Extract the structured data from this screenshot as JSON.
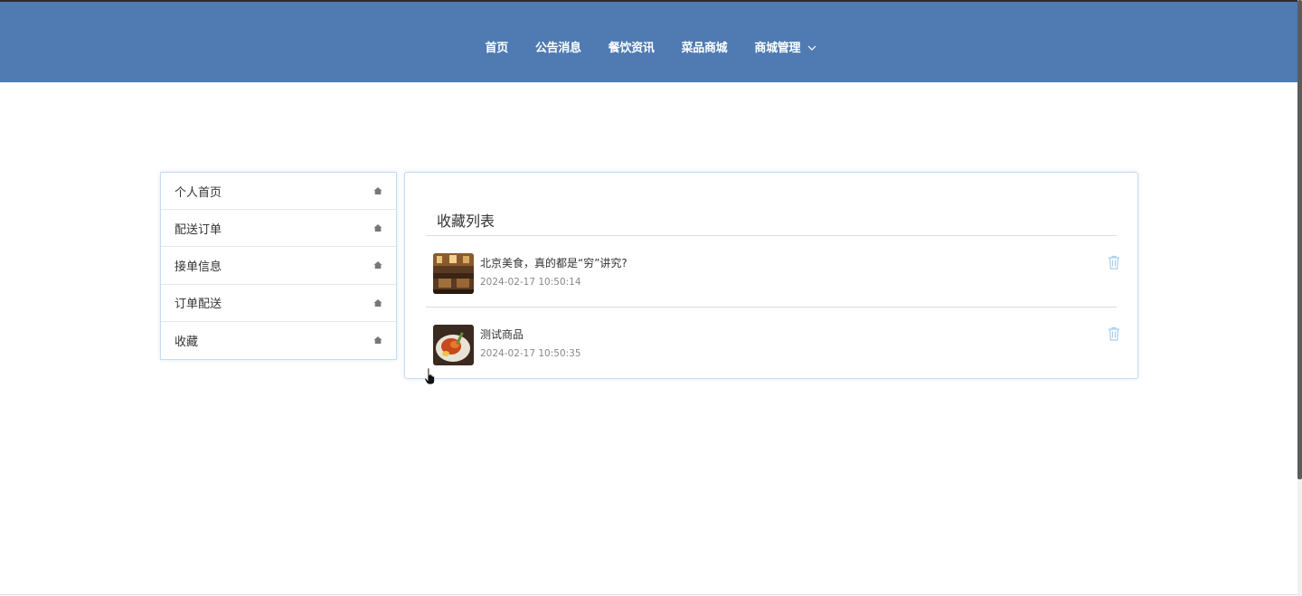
{
  "nav": {
    "items": [
      {
        "label": "首页"
      },
      {
        "label": "公告消息"
      },
      {
        "label": "餐饮资讯"
      },
      {
        "label": "菜品商城"
      },
      {
        "label": "商城管理",
        "dropdown": true
      }
    ],
    "background_color": "#4f7bb2",
    "chevron_icon": "chevron-down-icon"
  },
  "sidebar": {
    "items": [
      {
        "label": "个人首页",
        "icon": "home-icon"
      },
      {
        "label": "配送订单",
        "icon": "home-icon"
      },
      {
        "label": "接单信息",
        "icon": "home-icon"
      },
      {
        "label": "订单配送",
        "icon": "home-icon"
      },
      {
        "label": "收藏",
        "icon": "home-icon"
      }
    ]
  },
  "favorites": {
    "title": "收藏列表",
    "items": [
      {
        "name": "北京美食，真的都是“穷”讲究?",
        "time": "2024-02-17 10:50:14",
        "thumb_icon": "restaurant-photo",
        "action_icon": "trash-icon"
      },
      {
        "name": "测试商品",
        "time": "2024-02-17 10:50:35",
        "thumb_icon": "food-photo",
        "action_icon": "trash-icon"
      }
    ]
  },
  "colors": {
    "accent": "#4f7bb2",
    "card_border": "#c5dcf2",
    "trash_icon": "#a9cde9"
  }
}
